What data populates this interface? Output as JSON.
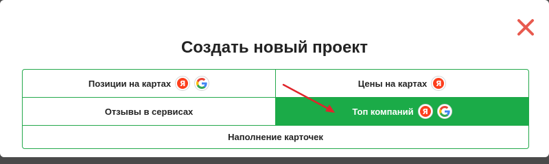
{
  "modal": {
    "title": "Создать новый проект"
  },
  "options": {
    "positions": "Позиции на картах",
    "prices": "Цены на картах",
    "reviews": "Отзывы в сервисах",
    "top": "Топ компаний",
    "filling": "Наполнение карточек"
  },
  "icons": {
    "yandex_letter": "Я",
    "yandex_color": "#fc3f1d",
    "google": "google-icon",
    "close": "close-icon"
  },
  "colors": {
    "accent": "#1bab48",
    "close": "#e85a4f",
    "annotation_arrow": "#e0242b"
  }
}
